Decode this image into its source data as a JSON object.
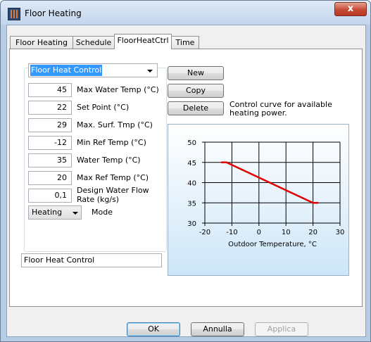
{
  "window": {
    "title": "Floor Heating",
    "close_label": "x"
  },
  "tabs": [
    {
      "label": "Floor Heating",
      "active": false
    },
    {
      "label": "Schedule",
      "active": false
    },
    {
      "label": "FloorHeatCtrl",
      "active": true
    },
    {
      "label": "Time",
      "active": false
    }
  ],
  "control_select": {
    "value": "Floor Heat Control"
  },
  "fields": [
    {
      "value": "45",
      "label": "Max Water Temp (°C)"
    },
    {
      "value": "22",
      "label": "Set Point (°C)"
    },
    {
      "value": "29",
      "label": "Max. Surf. Tmp (°C)"
    },
    {
      "value": "-12",
      "label": "Min Ref Temp (°C)"
    },
    {
      "value": "35",
      "label": "Water Temp (°C)"
    },
    {
      "value": "20",
      "label": "Max Ref Temp (°C)"
    },
    {
      "value": "0,1",
      "label": "Design Water Flow Rate (kg/s)"
    }
  ],
  "mode": {
    "value": "Heating",
    "label": "Mode"
  },
  "name_field": {
    "value": "Floor Heat Control"
  },
  "buttons": {
    "new": "New",
    "copy": "Copy",
    "delete": "Delete"
  },
  "chart_caption": "Control curve for available heating power.",
  "dialog_buttons": {
    "ok": "OK",
    "cancel": "Annulla",
    "apply": "Applica"
  },
  "chart_data": {
    "type": "line",
    "xlabel": "Outdoor Temperature, °C",
    "ylabel": "",
    "xlim": [
      -20,
      30
    ],
    "ylim": [
      30,
      50
    ],
    "xticks": [
      "-20",
      "-10",
      "0",
      "10",
      "20",
      "30"
    ],
    "yticks": [
      "30",
      "35",
      "40",
      "45",
      "50"
    ],
    "grid": true,
    "series": [
      {
        "x": [
          -14,
          -12,
          20,
          22
        ],
        "y": [
          45,
          45,
          35,
          35
        ],
        "color": "#e00000"
      }
    ]
  }
}
